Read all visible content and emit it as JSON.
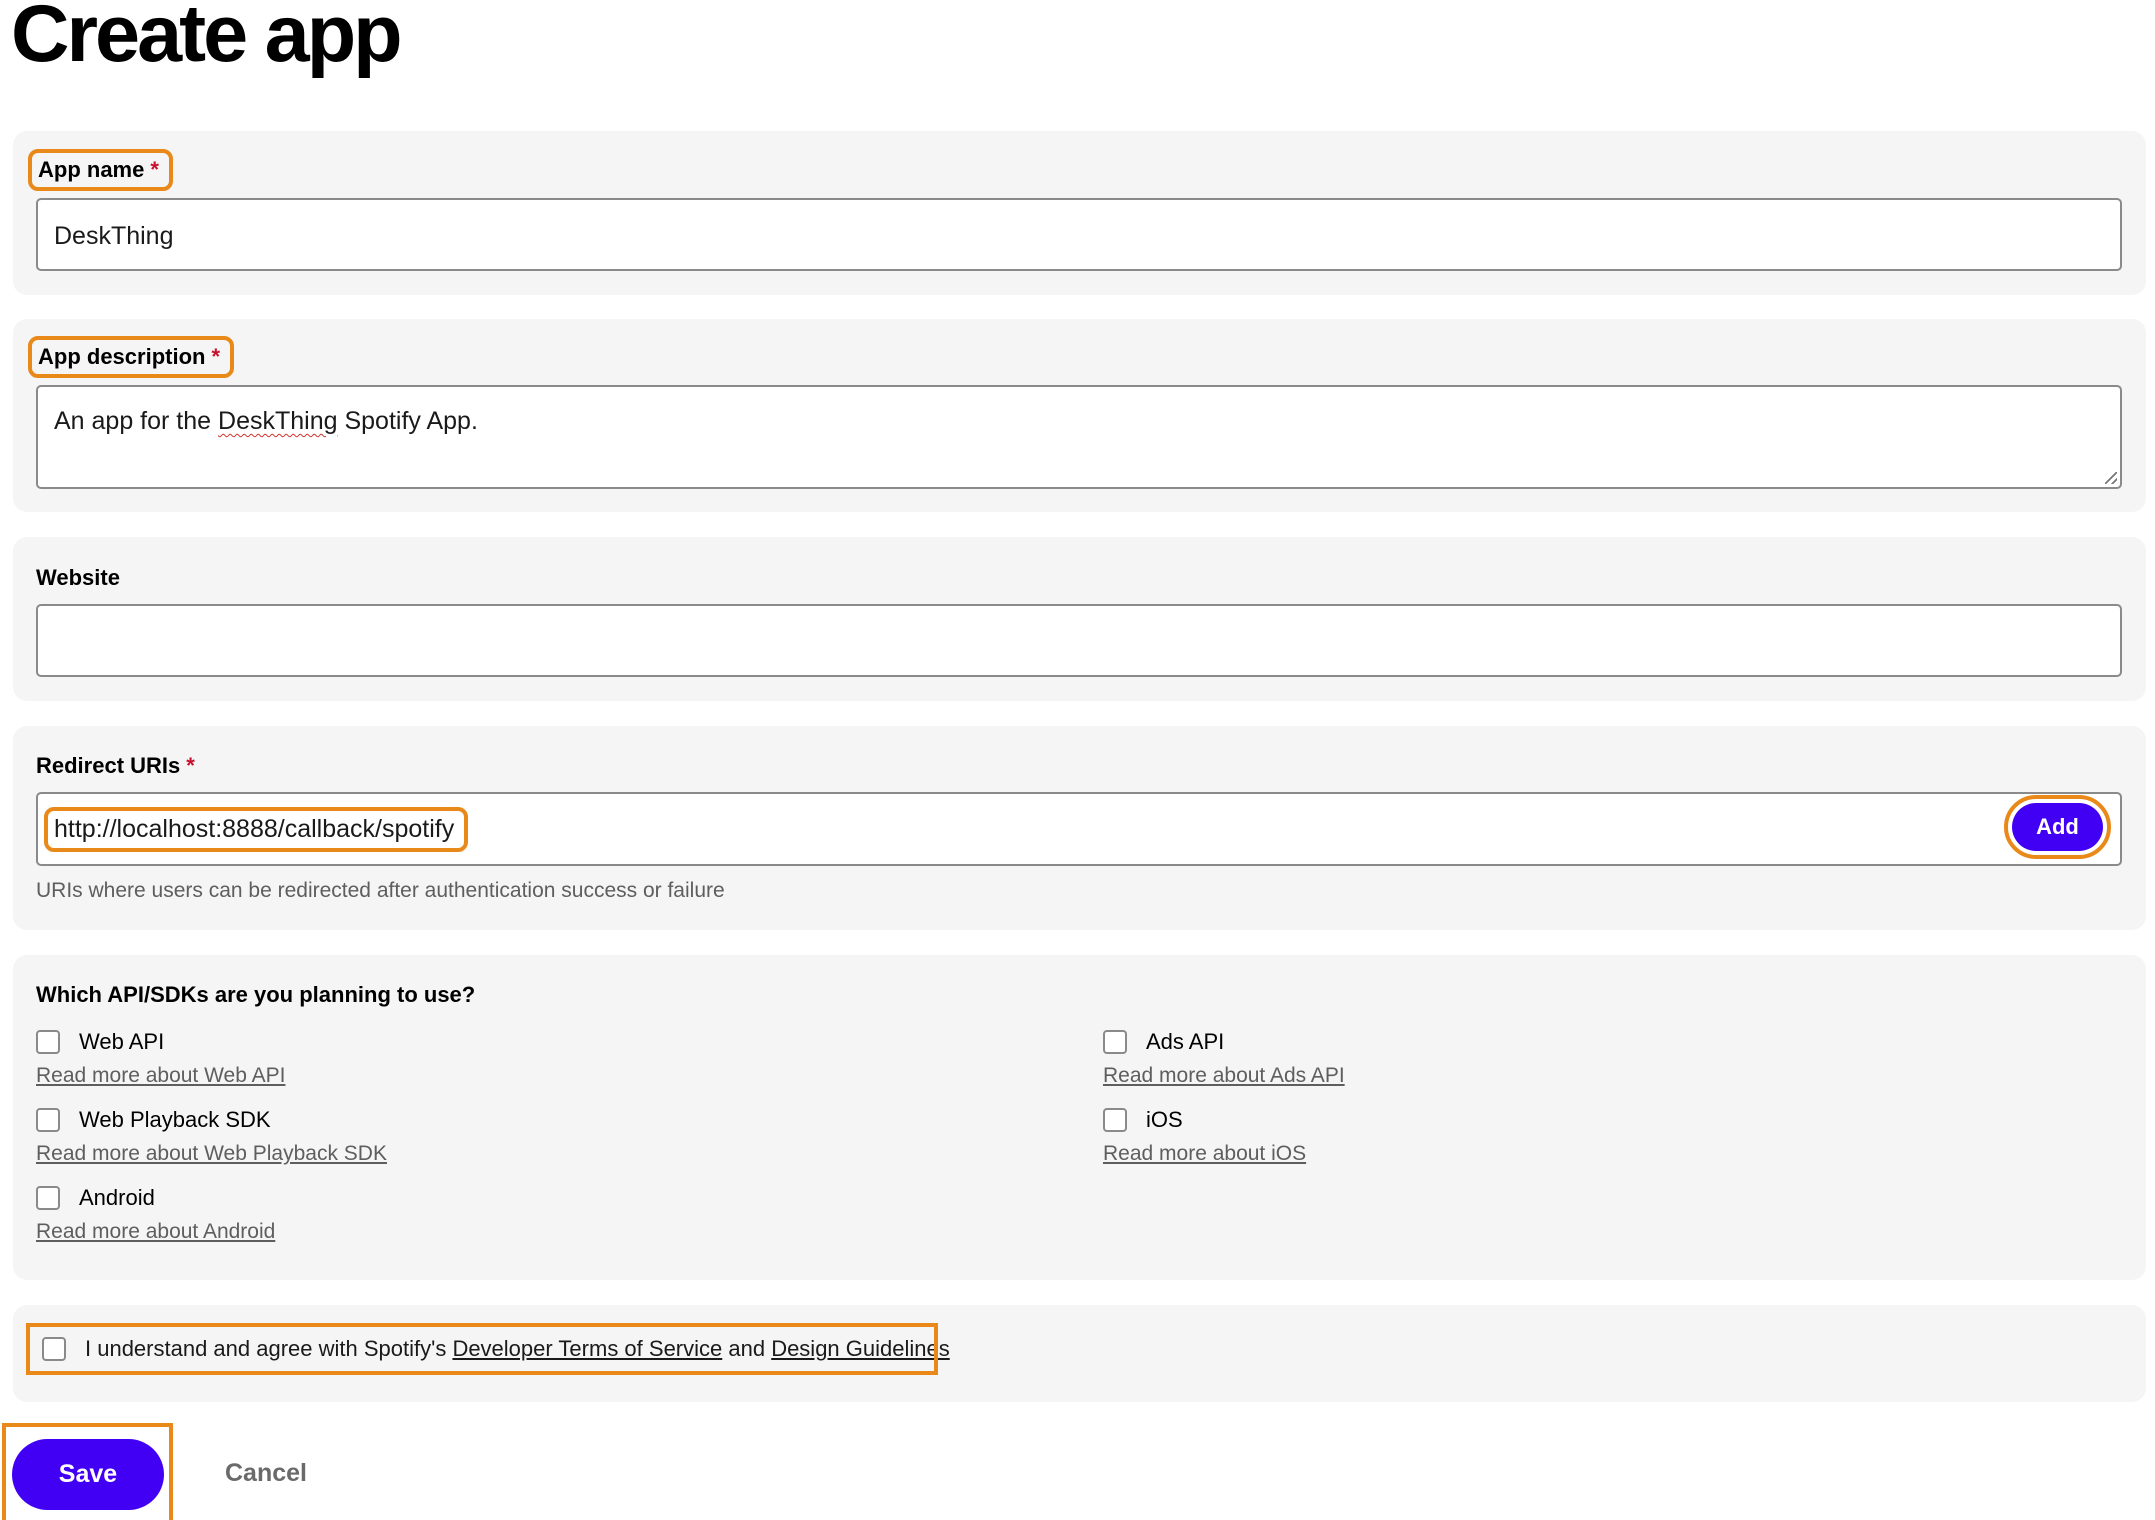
{
  "page": {
    "title": "Create app"
  },
  "app_name": {
    "label": "App name",
    "required_mark": "*",
    "value": "DeskThing"
  },
  "app_description": {
    "label": "App description",
    "required_mark": "*",
    "value_prefix": "An app for the ",
    "value_misspelled": "DeskThing",
    "value_suffix": " Spotify App."
  },
  "website": {
    "label": "Website",
    "value": ""
  },
  "redirect_uris": {
    "label": "Redirect URIs",
    "required_mark": "*",
    "value": "http://localhost:8888/callback/spotify",
    "add_label": "Add",
    "helper": "URIs where users can be redirected after authentication success or failure"
  },
  "apis": {
    "question": "Which API/SDKs are you planning to use?",
    "items": [
      {
        "label": "Web API",
        "link": "Read more about Web API",
        "checked": false
      },
      {
        "label": "Web Playback SDK",
        "link": "Read more about Web Playback SDK",
        "checked": false
      },
      {
        "label": "Android",
        "link": "Read more about Android",
        "checked": false
      },
      {
        "label": "Ads API",
        "link": "Read more about Ads API",
        "checked": false
      },
      {
        "label": "iOS",
        "link": "Read more about iOS",
        "checked": false
      }
    ]
  },
  "terms": {
    "prefix": "I understand and agree with Spotify's ",
    "tos_link": "Developer Terms of Service",
    "middle": " and ",
    "guidelines_link": "Design Guidelines",
    "checked": false
  },
  "actions": {
    "save_label": "Save",
    "cancel_label": "Cancel"
  },
  "colors": {
    "primary_button": "#4100f4",
    "highlight_outline": "#e8891a",
    "required_asterisk": "#c8102e",
    "card_background": "#f5f5f5"
  }
}
